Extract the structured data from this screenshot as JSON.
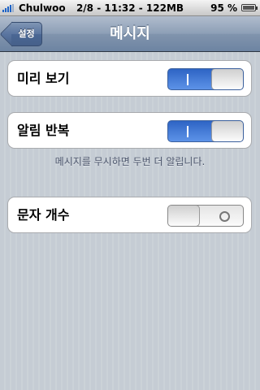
{
  "status_bar": {
    "carrier": "Chulwoo",
    "time": "2/8 - 11:32 - 122MB",
    "battery": "95 %",
    "signal_icon": "signal-bars-icon",
    "battery_icon": "battery-icon"
  },
  "nav": {
    "back_label": "설정",
    "title": "메시지"
  },
  "settings": {
    "preview": {
      "label": "미리 보기",
      "toggle_on": true
    },
    "repeat_alert": {
      "label": "알림 반복",
      "toggle_on": true
    },
    "repeat_alert_footer": "메시지를 무시하면 두번 더 알립니다.",
    "char_count": {
      "label": "문자 개수",
      "toggle_on": false
    }
  },
  "colors": {
    "toggle_on": "#2e64c4",
    "nav_bar": "#6d84a2"
  }
}
